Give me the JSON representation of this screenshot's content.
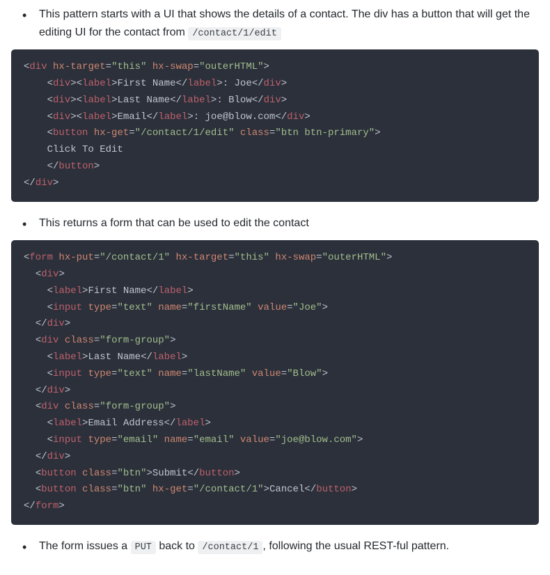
{
  "bullets": {
    "b1_part1": "This pattern starts with a UI that shows the details of a contact. The div has a button that will get the editing UI for the contact from ",
    "b1_code": "/contact/1/edit",
    "b2": "This returns a form that can be used to edit the contact",
    "b3_part1": "The form issues a ",
    "b3_code1": "PUT",
    "b3_part2": " back to ",
    "b3_code2": "/contact/1",
    "b3_part3": ", following the usual REST-ful pattern."
  },
  "code1": {
    "l1": {
      "t1": "div",
      "a1": "hx-target",
      "v1": "\"this\"",
      "a2": "hx-swap",
      "v2": "\"outerHTML\""
    },
    "l2": {
      "t1": "div",
      "t2": "label",
      "txt1": "First Name",
      "t3": "label",
      "txt2": ": Joe",
      "t4": "div"
    },
    "l3": {
      "t1": "div",
      "t2": "label",
      "txt1": "Last Name",
      "t3": "label",
      "txt2": ": Blow",
      "t4": "div"
    },
    "l4": {
      "t1": "div",
      "t2": "label",
      "txt1": "Email",
      "t3": "label",
      "txt2": ": joe@blow.com",
      "t4": "div"
    },
    "l5": {
      "t1": "button",
      "a1": "hx-get",
      "v1": "\"/contact/1/edit\"",
      "a2": "class",
      "v2": "\"btn btn-primary\""
    },
    "l6": {
      "txt": "    Click To Edit"
    },
    "l7": {
      "t1": "button"
    },
    "l8": {
      "t1": "div"
    }
  },
  "code2": {
    "l1": {
      "t1": "form",
      "a1": "hx-put",
      "v1": "\"/contact/1\"",
      "a2": "hx-target",
      "v2": "\"this\"",
      "a3": "hx-swap",
      "v3": "\"outerHTML\""
    },
    "l2": {
      "t1": "div"
    },
    "l3": {
      "t1": "label",
      "txt1": "First Name",
      "t2": "label"
    },
    "l4": {
      "t1": "input",
      "a1": "type",
      "v1": "\"text\"",
      "a2": "name",
      "v2": "\"firstName\"",
      "a3": "value",
      "v3": "\"Joe\""
    },
    "l5": {
      "t1": "div"
    },
    "l6": {
      "t1": "div",
      "a1": "class",
      "v1": "\"form-group\""
    },
    "l7": {
      "t1": "label",
      "txt1": "Last Name",
      "t2": "label"
    },
    "l8": {
      "t1": "input",
      "a1": "type",
      "v1": "\"text\"",
      "a2": "name",
      "v2": "\"lastName\"",
      "a3": "value",
      "v3": "\"Blow\""
    },
    "l9": {
      "t1": "div"
    },
    "l10": {
      "t1": "div",
      "a1": "class",
      "v1": "\"form-group\""
    },
    "l11": {
      "t1": "label",
      "txt1": "Email Address",
      "t2": "label"
    },
    "l12": {
      "t1": "input",
      "a1": "type",
      "v1": "\"email\"",
      "a2": "name",
      "v2": "\"email\"",
      "a3": "value",
      "v3": "\"joe@blow.com\""
    },
    "l13": {
      "t1": "div"
    },
    "l14": {
      "t1": "button",
      "a1": "class",
      "v1": "\"btn\"",
      "txt1": "Submit",
      "t2": "button"
    },
    "l15": {
      "t1": "button",
      "a1": "class",
      "v1": "\"btn\"",
      "a2": "hx-get",
      "v2": "\"/contact/1\"",
      "txt1": "Cancel",
      "t2": "button"
    },
    "l16": {
      "t1": "form"
    }
  }
}
